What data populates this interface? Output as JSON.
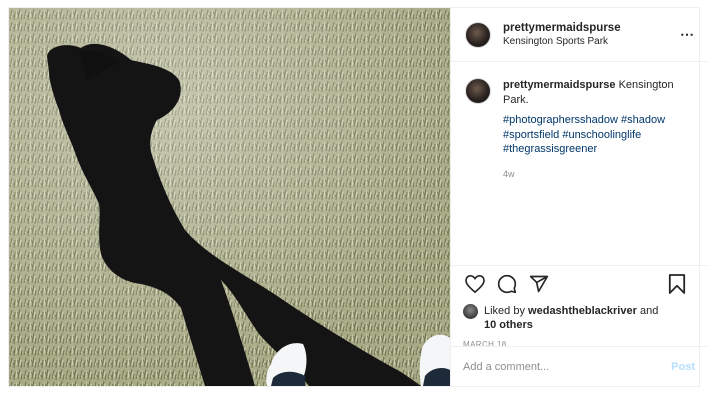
{
  "post": {
    "header": {
      "username": "prettymermaidspurse",
      "location": "Kensington Sports Park",
      "more_icon": "⋯"
    },
    "caption": {
      "username": "prettymermaidspurse",
      "text": "Kensington Park.",
      "hashtags": [
        "#photographersshadow",
        "#shadow",
        "#sportsfield",
        "#unschoolinglife",
        "#thegrassisgreener"
      ],
      "time_ago": "4w"
    },
    "actions": {
      "like_icon": "heart-icon",
      "comment_icon": "comment-icon",
      "share_icon": "share-icon",
      "save_icon": "bookmark-icon"
    },
    "likes": {
      "prefix": "Liked by",
      "user": "wedashtheblackriver",
      "middle": "and",
      "others": "10 others"
    },
    "date": "MARCH 18",
    "comment": {
      "placeholder": "Add a comment...",
      "post_label": "Post"
    }
  }
}
